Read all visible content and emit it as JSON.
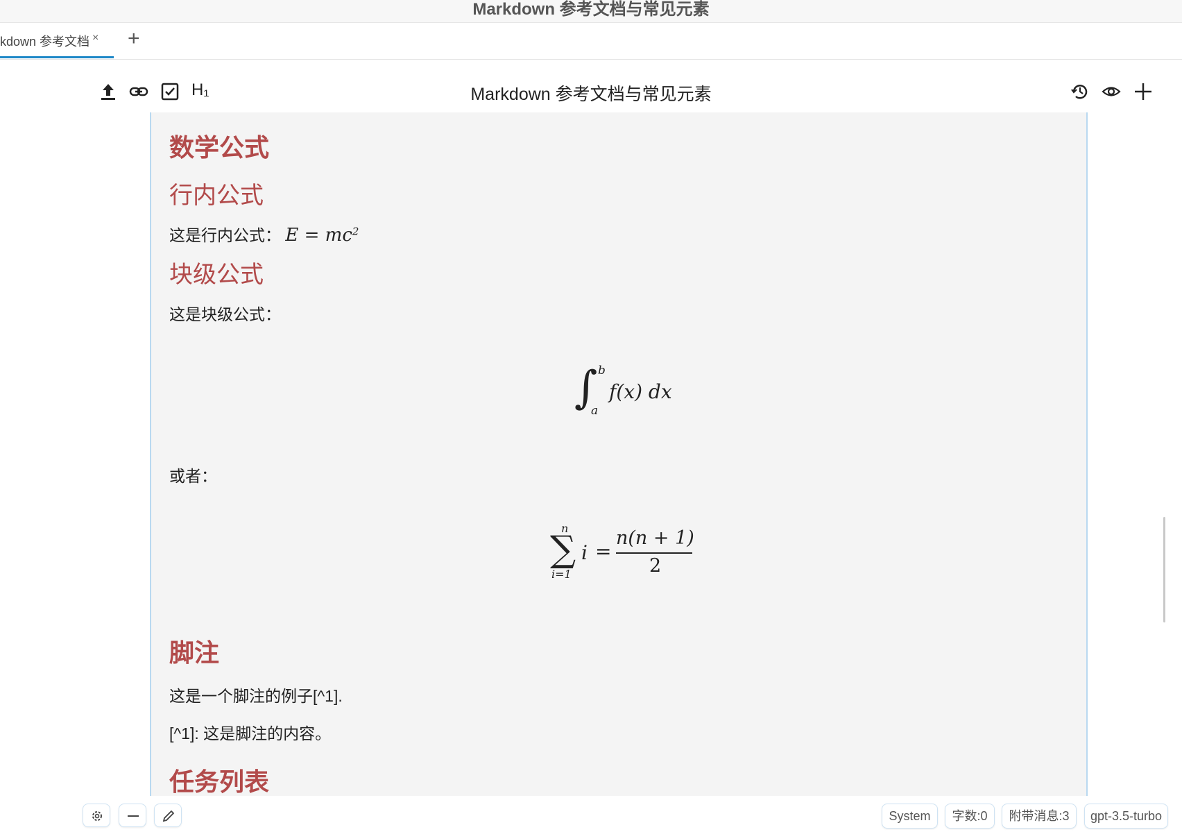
{
  "window": {
    "title": "Markdown 参考文档与常见元素"
  },
  "tabs": [
    {
      "label": "kdown 参考文档",
      "close": "×"
    }
  ],
  "tab_add": "+",
  "toolbar": {
    "title": "Markdown 参考文档与常见元素",
    "h1_label": "H₁",
    "icons": [
      "upload-icon",
      "link-icon",
      "checkbox-icon",
      "history-icon",
      "eye-icon",
      "plus-icon"
    ]
  },
  "content": {
    "h_math": "数学公式",
    "h_inline": "行内公式",
    "p_inline": "这是行内公式：",
    "inline_formula": "E = mc",
    "inline_sup": "2",
    "h_block": "块级公式",
    "p_block": "这是块级公式：",
    "integral_lower": "a",
    "integral_upper": "b",
    "integral_body": "f(x) dx",
    "p_or": "或者：",
    "sum_upper": "n",
    "sum_lower": "i=1",
    "sum_var": "i",
    "sum_num": "n(n + 1)",
    "sum_den": "2",
    "h_footnote": "脚注",
    "p_footnote": "这是一个脚注的例子[^1].",
    "p_footnote_def": "[^1]: 这是脚注的内容。",
    "h_tasks": "任务列表"
  },
  "status": {
    "role": "System",
    "word_count": "字数:0",
    "attached": "附带消息:3",
    "model": "gpt-3.5-turbo"
  },
  "bottom_icons": [
    "gear-icon",
    "minus-icon",
    "pencil-icon"
  ]
}
